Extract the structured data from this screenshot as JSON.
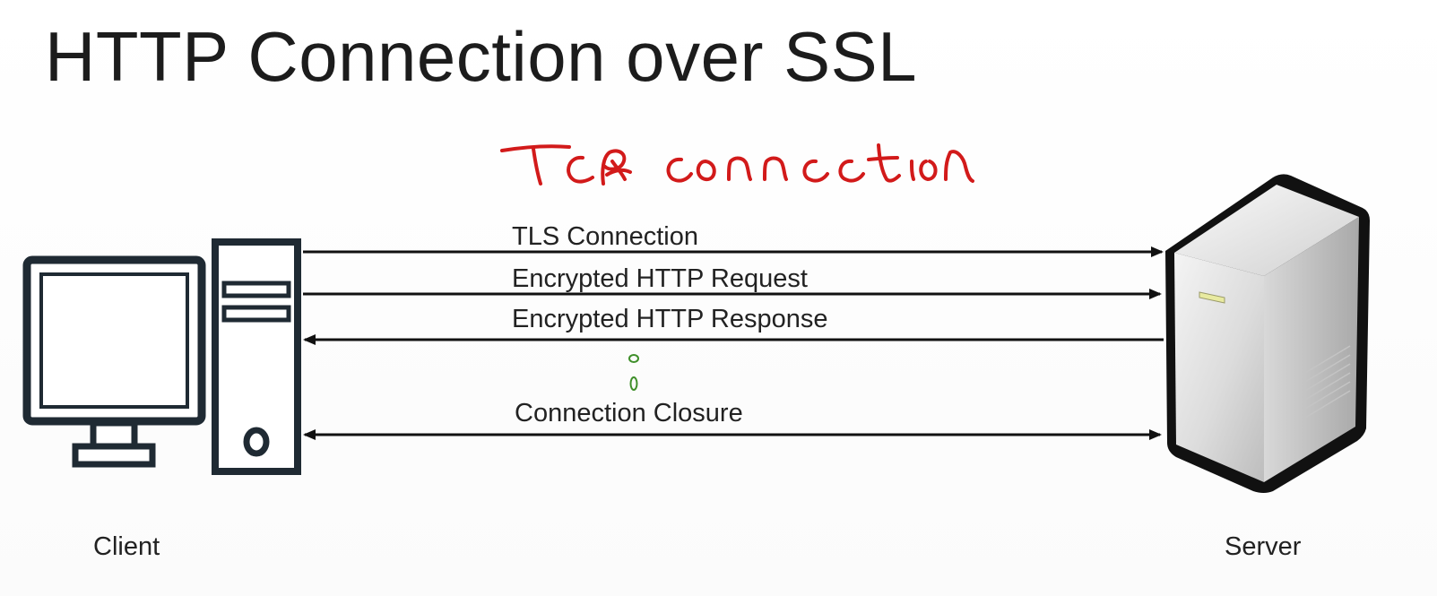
{
  "title": "HTTP Connection over SSL",
  "handwritten_note": "TCP connection",
  "actors": {
    "client": "Client",
    "server": "Server"
  },
  "messages": [
    {
      "label": "TLS Connection",
      "direction": "client-to-server"
    },
    {
      "label": "Encrypted HTTP Request",
      "direction": "client-to-server"
    },
    {
      "label": "Encrypted HTTP Response",
      "direction": "server-to-client"
    },
    {
      "label": "Connection Closure",
      "direction": "bidirectional"
    }
  ],
  "colors": {
    "ink": "#111111",
    "annotation_red": "#d21a1a",
    "annotation_green": "#3f8f2a"
  }
}
